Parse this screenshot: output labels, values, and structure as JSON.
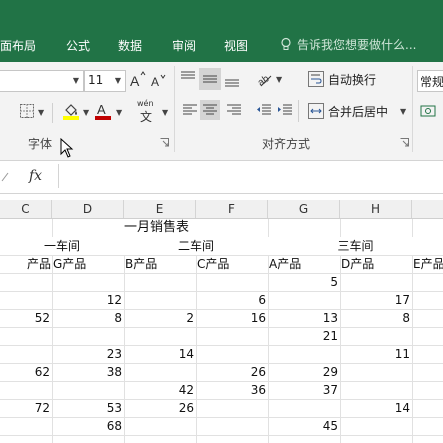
{
  "menu": {
    "tabs": [
      "面布局",
      "公式",
      "数据",
      "审阅",
      "视图"
    ],
    "tell_me": "告诉我您想要做什么..."
  },
  "ribbon": {
    "font_size": "11",
    "wen_label": "wén",
    "wen_char": "文",
    "font_group_label": "字体",
    "align_group_label": "对齐方式",
    "wrap_text": "自动换行",
    "merge_center": "合并后居中",
    "number_format": "常规"
  },
  "formula_bar": {
    "fx": "fx",
    "value": ""
  },
  "sheet": {
    "columns": [
      "C",
      "D",
      "E",
      "F",
      "G",
      "H"
    ],
    "title": "一月销售表",
    "workshops": [
      "一车间",
      "二车间",
      "三车间"
    ],
    "product_headers": [
      "产品",
      "G产品",
      "B产品",
      "C产品",
      "A产品",
      "D产品",
      "E产品"
    ],
    "rows": [
      [
        "",
        "",
        "",
        "",
        "5",
        ""
      ],
      [
        "",
        "12",
        "",
        "6",
        "",
        "17"
      ],
      [
        "52",
        "8",
        "2",
        "16",
        "13",
        "8"
      ],
      [
        "",
        "",
        "",
        "",
        "21",
        ""
      ],
      [
        "",
        "23",
        "14",
        "",
        "",
        "11"
      ],
      [
        "62",
        "38",
        "",
        "26",
        "29",
        ""
      ],
      [
        "",
        "",
        "42",
        "36",
        "37",
        ""
      ],
      [
        "72",
        "53",
        "26",
        "",
        "",
        "14"
      ],
      [
        "",
        "68",
        "",
        "",
        "45",
        ""
      ],
      [
        "",
        "",
        "",
        "",
        "",
        ""
      ]
    ]
  },
  "colors": {
    "excel_green": "#217346",
    "font_color_red": "#c00000",
    "fill_yellow": "#ffff00"
  }
}
